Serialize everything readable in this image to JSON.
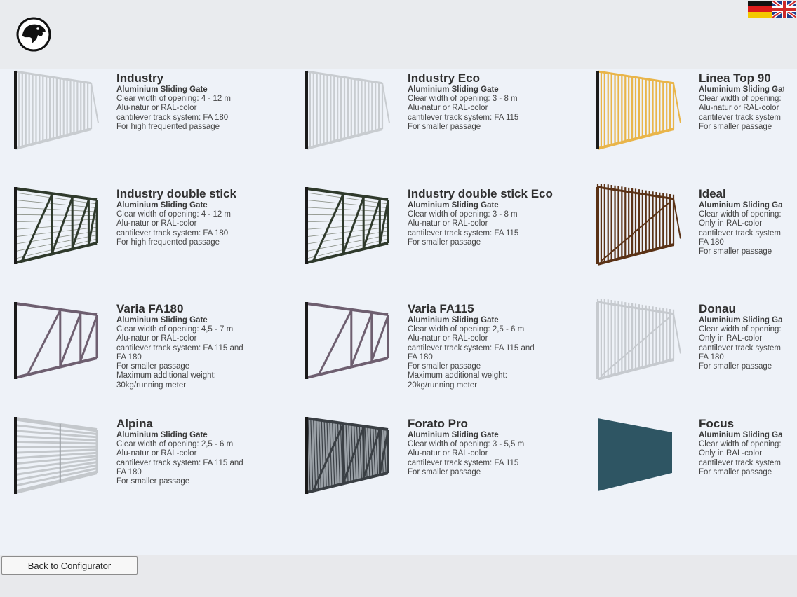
{
  "header": {
    "logo_icon": "eagle-logo-icon",
    "languages": [
      {
        "code": "de",
        "icon": "german-flag-icon"
      },
      {
        "code": "en",
        "icon": "uk-flag-icon"
      }
    ]
  },
  "gates": [
    {
      "title": "Industry",
      "subtitle": "Aluminium Sliding Gate",
      "lines": [
        "Clear width of opening: 4 - 12 m",
        "Alu-natur or RAL-color",
        "cantilever track system: FA 180",
        "For high frequented passage"
      ],
      "style": "bars",
      "color": "#c8ccd0"
    },
    {
      "title": "Industry Eco",
      "subtitle": "Aluminium Sliding Gate",
      "lines": [
        "Clear width of opening: 3 - 8 m",
        "Alu-natur or RAL-color",
        "cantilever track system: FA 115",
        "For smaller passage"
      ],
      "style": "bars",
      "color": "#c8ccd0"
    },
    {
      "title": "Linea Top 90",
      "subtitle": "Aluminium Sliding Gate",
      "lines": [
        "Clear width of opening:",
        "Alu-natur or RAL-color",
        "cantilever track system",
        "For smaller passage"
      ],
      "style": "bars",
      "color": "#e9b54a"
    },
    {
      "title": "Industry double stick",
      "subtitle": "Aluminium Sliding Gate",
      "lines": [
        "Clear width of opening: 4 - 12 m",
        "Alu-natur or RAL-color",
        "cantilever track system: FA 180",
        "For high frequented passage"
      ],
      "style": "mesh",
      "color": "#2f3a2c"
    },
    {
      "title": "Industry double stick Eco",
      "subtitle": "Aluminium Sliding Gate",
      "lines": [
        "Clear width of opening: 3 - 8 m",
        "Alu-natur or RAL-color",
        "cantilever track system: FA 115",
        "For smaller passage"
      ],
      "style": "mesh",
      "color": "#2f3a2c"
    },
    {
      "title": "Ideal",
      "subtitle": "Aluminium Sliding Ga",
      "lines": [
        "Clear width of opening:",
        "Only in RAL-color",
        "cantilever track system",
        "FA 180",
        "For smaller passage"
      ],
      "style": "pickets",
      "color": "#5a3216"
    },
    {
      "title": "Varia FA180",
      "subtitle": "Aluminium Sliding Gate",
      "lines": [
        "Clear width of opening: 4,5 - 7 m",
        "Alu-natur or RAL-color",
        "cantilever track system: FA 115 and",
        "FA 180",
        "For smaller passage",
        "Maximum additional weight:",
        "30kg/running meter"
      ],
      "style": "truss",
      "color": "#6e5f70"
    },
    {
      "title": "Varia FA115",
      "subtitle": "Aluminium Sliding Gate",
      "lines": [
        "Clear width of opening: 2,5 - 6 m",
        "Alu-natur or RAL-color",
        "cantilever track system: FA 115 and",
        "FA 180",
        "For smaller passage",
        "Maximum additional weight:",
        "20kg/running meter"
      ],
      "style": "truss",
      "color": "#6e5f70"
    },
    {
      "title": "Donau",
      "subtitle": "Aluminium Sliding Ga",
      "lines": [
        "Clear width of opening:",
        "Only in RAL-color",
        "cantilever track system",
        "FA 180",
        "For smaller passage"
      ],
      "style": "pickets",
      "color": "#c6cacf"
    },
    {
      "title": "Alpina",
      "subtitle": "Aluminium Sliding Gate",
      "lines": [
        "Clear width of opening: 2,5 - 6 m",
        "Alu-natur or RAL-color",
        "cantilever track system: FA 115 and",
        "FA 180",
        "For smaller passage"
      ],
      "style": "louver",
      "color": "#c4c8cc"
    },
    {
      "title": "Forato Pro",
      "subtitle": "Aluminium Sliding Gate",
      "lines": [
        "Clear width of opening: 3 - 5,5 m",
        "Alu-natur or RAL-color",
        "cantilever track system: FA 115",
        "For smaller passage"
      ],
      "style": "perforated",
      "color": "#3a3f44"
    },
    {
      "title": "Focus",
      "subtitle": "Aluminium Sliding Ga",
      "lines": [
        "Clear width of opening:",
        "Only in RAL-color",
        "cantilever track system",
        "For smaller passage"
      ],
      "style": "solid",
      "color": "#2e5563"
    }
  ],
  "footer": {
    "back_label": "Back to Configurator"
  }
}
